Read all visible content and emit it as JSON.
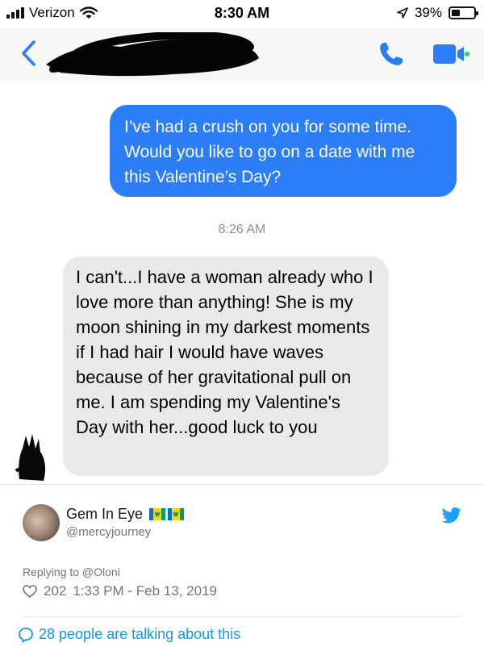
{
  "status_bar": {
    "carrier": "Verizon",
    "time": "8:30 AM",
    "battery_percent": "39%",
    "battery_level": 0.39,
    "icons": [
      "signal-bars-icon",
      "wifi-icon",
      "location-arrow-icon",
      "battery-icon"
    ]
  },
  "nav": {
    "icons": [
      "back-chevron-icon",
      "phone-icon",
      "video-camera-icon"
    ],
    "contact_name_redacted": true
  },
  "conversation": {
    "sent_message": "I’ve had a crush on you for some time. Would you like to go on a date with me this Valentine’s Day?",
    "timestamp": "8:26 AM",
    "received_message": "I can't...I have a woman already who I love more than anything! She is my moon shining in my darkest moments if I had hair I would have waves because of her gravitational pull on me. I am spending my Valentine's Day with her...good luck to you"
  },
  "tweet": {
    "name": "Gem In Eye",
    "handle": "@mercyjourney",
    "replying_to": "Replying to @Oloni",
    "likes": "202",
    "datetime": "1:33 PM - Feb 13, 2019",
    "talking": "28 people are talking about this",
    "colors": {
      "link": "#1b95e0",
      "muted": "#657786",
      "bubble_sent": "#2b7ef8",
      "bubble_received": "#e9e9eb"
    }
  }
}
